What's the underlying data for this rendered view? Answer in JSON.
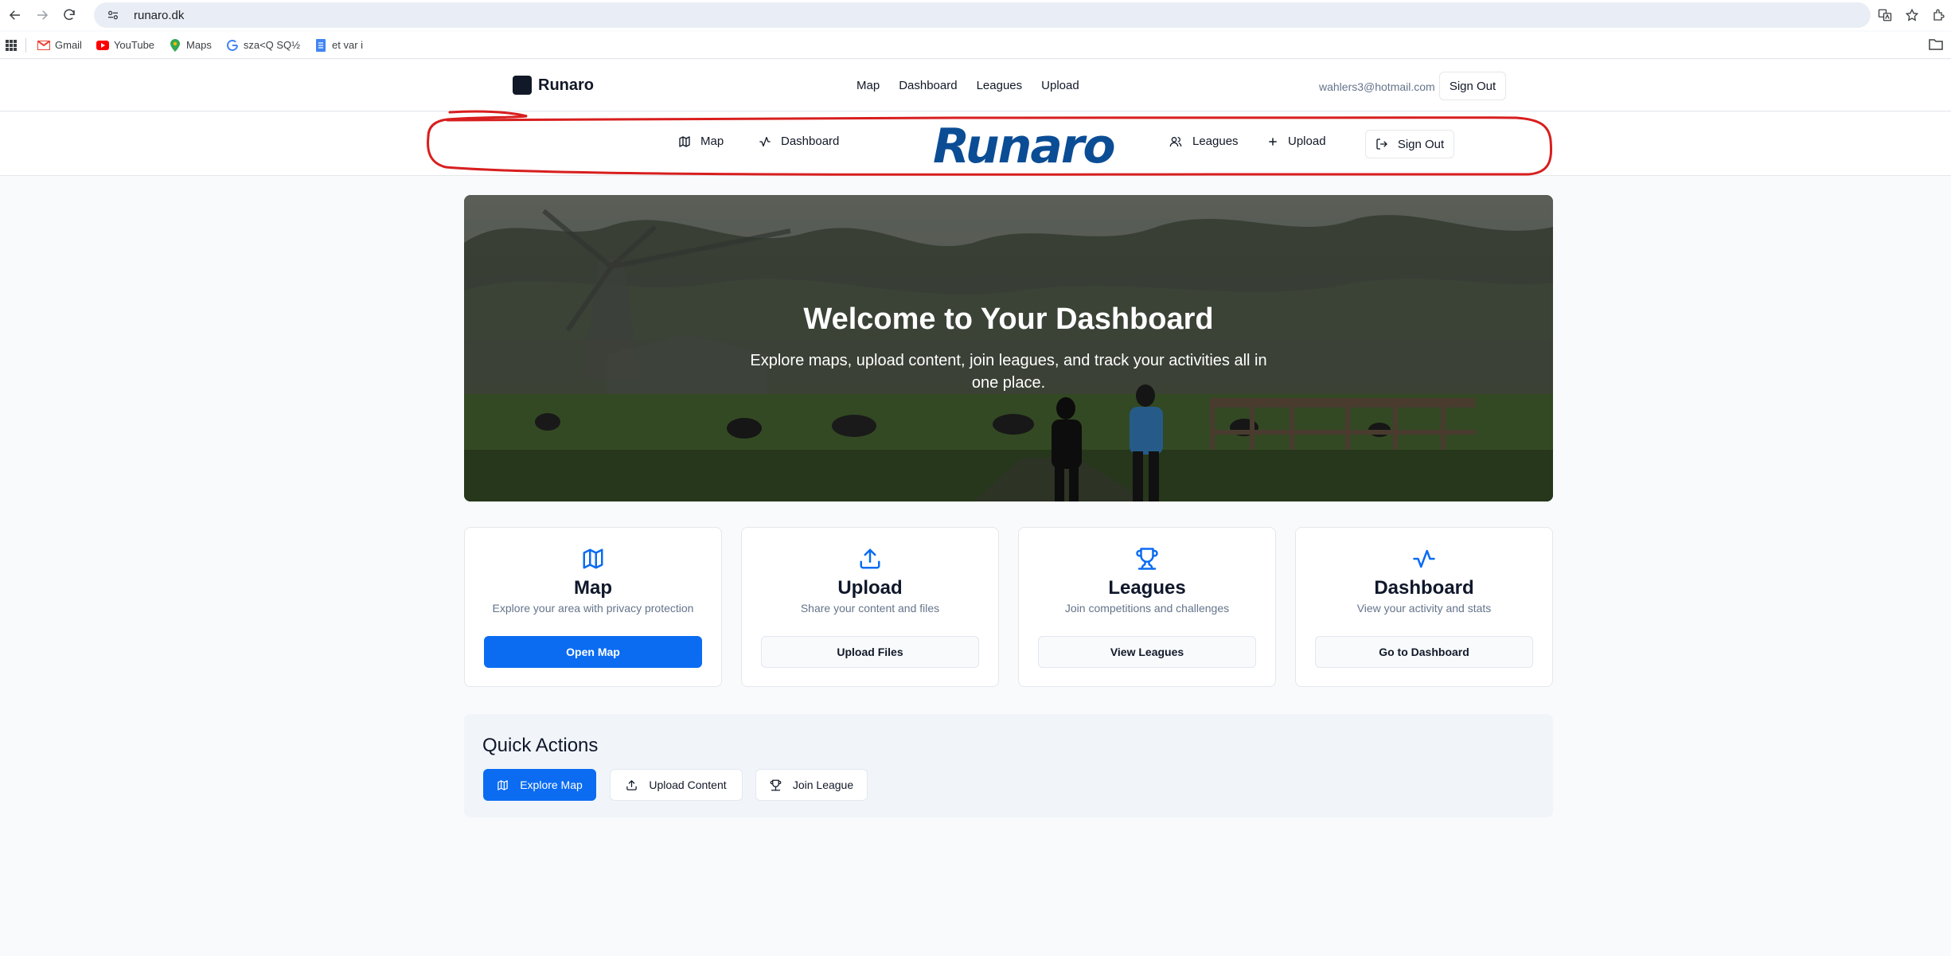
{
  "browser": {
    "url": "runaro.dk",
    "bookmarks": [
      "Gmail",
      "YouTube",
      "Maps",
      "sza<Q SQ½",
      "et var i"
    ]
  },
  "header": {
    "brand": "Runaro",
    "links": [
      "Map",
      "Dashboard",
      "Leagues",
      "Upload"
    ],
    "user_email": "wahlers3@hotmail.com",
    "sign_out": "Sign Out"
  },
  "subnav": {
    "logo": "Runaro",
    "items": [
      "Map",
      "Dashboard",
      "Leagues",
      "Upload"
    ],
    "sign_out": "Sign Out",
    "annotation_color": "#d81e1e"
  },
  "hero": {
    "title": "Welcome to Your Dashboard",
    "subtitle": "Explore maps, upload content, join leagues, and track your activities all in one place."
  },
  "cards": [
    {
      "icon": "map-icon",
      "title": "Map",
      "description": "Explore your area with privacy protection",
      "button": "Open Map",
      "primary": true
    },
    {
      "icon": "upload-icon",
      "title": "Upload",
      "description": "Share your content and files",
      "button": "Upload Files",
      "primary": false
    },
    {
      "icon": "trophy-icon",
      "title": "Leagues",
      "description": "Join competitions and challenges",
      "button": "View Leagues",
      "primary": false
    },
    {
      "icon": "activity-icon",
      "title": "Dashboard",
      "description": "View your activity and stats",
      "button": "Go to Dashboard",
      "primary": false
    }
  ],
  "quick_actions": {
    "title": "Quick Actions",
    "buttons": [
      "Explore Map",
      "Upload Content",
      "Join League"
    ]
  },
  "colors": {
    "primary": "#0b6cf2",
    "icon_blue": "#0b6cf2",
    "logo_blue": "#0b4d95"
  }
}
